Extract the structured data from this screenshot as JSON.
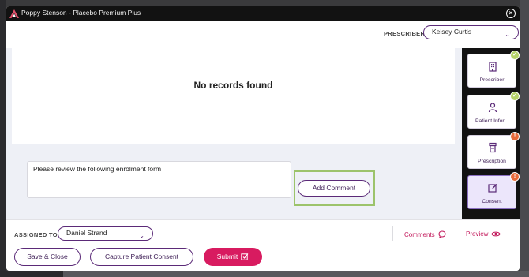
{
  "window": {
    "title": "Poppy Stenson - Placebo Premium Plus"
  },
  "header": {
    "prescriber_label": "PRESCRIBER",
    "prescriber_value": "Kelsey  Curtis"
  },
  "records": {
    "empty_message": "No records found"
  },
  "comment": {
    "text": "Please review the following enrolment form",
    "add_button": "Add Comment"
  },
  "steps": [
    {
      "label": "Prescriber",
      "icon": "building-icon",
      "status": "complete"
    },
    {
      "label": "Patient Infor...",
      "icon": "person-icon",
      "status": "complete"
    },
    {
      "label": "Prescription",
      "icon": "pill-bottle-icon",
      "status": "warning"
    },
    {
      "label": "Consent",
      "icon": "edit-icon",
      "status": "warning",
      "active": true
    }
  ],
  "badges": {
    "complete_glyph": "✓",
    "warning_glyph": "!"
  },
  "footer": {
    "assigned_label": "ASSIGNED TO",
    "assigned_value": "Daniel  Strand",
    "comments_link": "Comments",
    "preview_link": "Preview",
    "save_close": "Save & Close",
    "capture_consent": "Capture Patient Consent",
    "submit": "Submit"
  },
  "colors": {
    "accent_purple": "#5b2a78",
    "submit_pink": "#d81b60",
    "highlight_green": "#9cc36b",
    "titlebar": "#121212"
  }
}
